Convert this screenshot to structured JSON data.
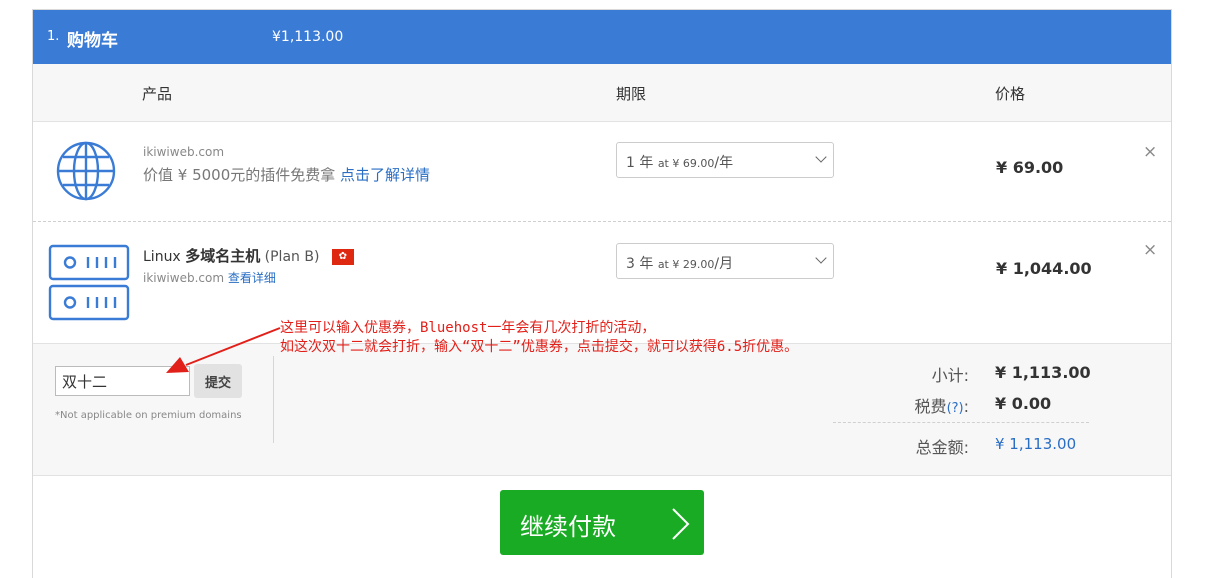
{
  "header": {
    "step": "1.",
    "title": "购物车",
    "total": "¥1,113.00"
  },
  "columns": {
    "product": "产品",
    "term": "期限",
    "price": "价格"
  },
  "items": [
    {
      "icon": "globe-icon",
      "domain": "ikiwiweb.com",
      "promo_text": "价值 ¥ 5000元的插件免费拿",
      "promo_link": "点击了解详情",
      "term_count": "1 年",
      "term_at": "at ¥ 69.00",
      "term_unit": "/年",
      "price": "¥ 69.00",
      "remove": "×"
    },
    {
      "icon": "server-icon",
      "name_prefix": "Linux",
      "name_main": "多域名主机",
      "name_plan": "(Plan B)",
      "flag": "香港",
      "domain": "ikiwiweb.com",
      "details_link": "查看详细",
      "term_count": "3 年",
      "term_at": "at ¥ 29.00",
      "term_unit": "/月",
      "price": "¥ 1,044.00",
      "remove": "×"
    }
  ],
  "coupon": {
    "value": "双十二",
    "button": "提交",
    "note": "*Not applicable on premium domains"
  },
  "summary": {
    "subtotal_label": "小计:",
    "subtotal": "¥ 1,113.00",
    "tax_label": "税费",
    "tax_help": "(?)",
    "tax_colon": ":",
    "tax": "¥ 0.00",
    "total_label": "总金额:",
    "total": "¥ 1,113.00"
  },
  "checkout": {
    "label": "继续付款"
  },
  "annotation": {
    "line1": "这里可以输入优惠券，Bluehost一年会有几次打折的活动，",
    "line2": "如这次双十二就会打折，输入“双十二”优惠券，点击提交，就可以获得6.5折优惠。",
    "color": "#e2201a"
  },
  "colors": {
    "header": "#3a7bd5",
    "link": "#2a6ec4",
    "checkout": "#1aab24"
  }
}
